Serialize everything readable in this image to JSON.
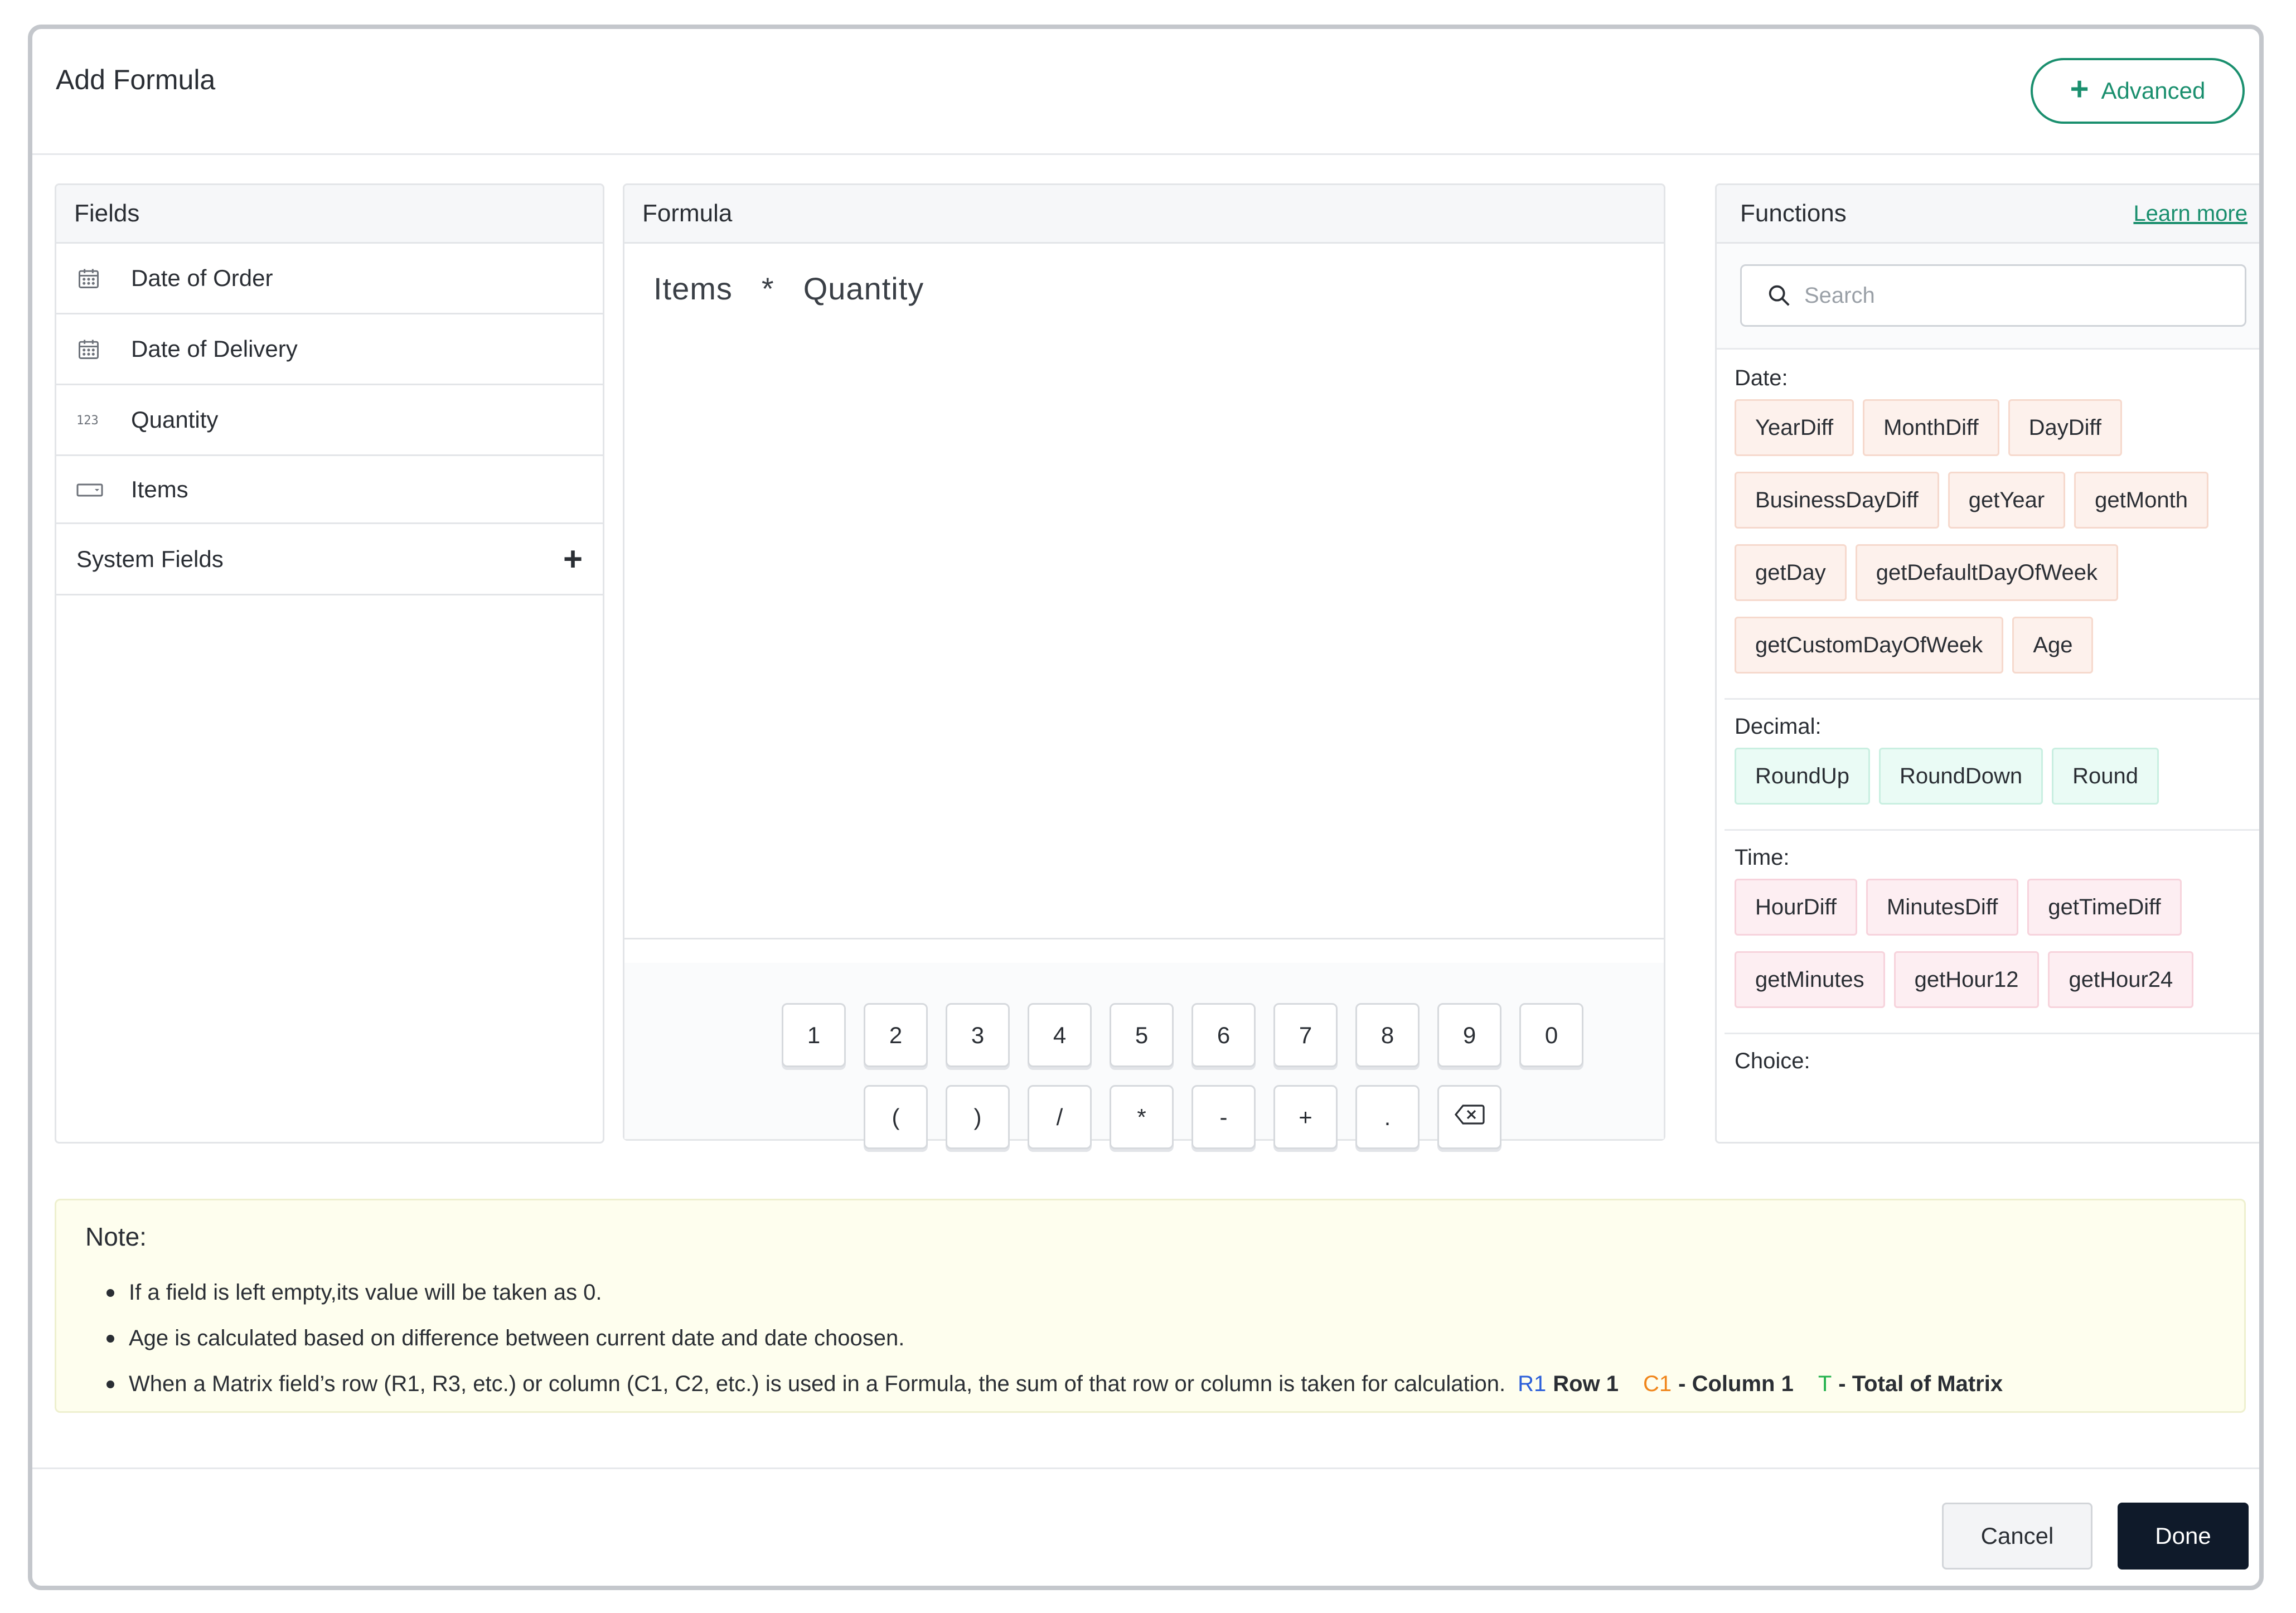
{
  "dialog": {
    "title": "Add Formula",
    "advanced_label": "Advanced"
  },
  "fields": {
    "header": "Fields",
    "items": [
      {
        "label": "Date of Order",
        "icon": "calendar-icon"
      },
      {
        "label": "Date of Delivery",
        "icon": "calendar-icon"
      },
      {
        "label": "Quantity",
        "icon": "number-123-icon"
      },
      {
        "label": "Items",
        "icon": "dropdown-field-icon"
      }
    ],
    "system_fields_label": "System Fields"
  },
  "formula": {
    "header": "Formula",
    "expression": [
      "Items",
      "*",
      "Quantity"
    ],
    "keypad_row1": [
      "1",
      "2",
      "3",
      "4",
      "5",
      "6",
      "7",
      "8",
      "9",
      "0"
    ],
    "keypad_row2": [
      "(",
      ")",
      "/",
      "*",
      "-",
      "+",
      "."
    ]
  },
  "functions": {
    "header": "Functions",
    "learn_more": "Learn more",
    "search_placeholder": "Search",
    "groups": [
      {
        "label": "Date:",
        "items": [
          "YearDiff",
          "MonthDiff",
          "DayDiff",
          "BusinessDayDiff",
          "getYear",
          "getMonth",
          "getDay",
          "getDefaultDayOfWeek",
          "getCustomDayOfWeek",
          "Age"
        ]
      },
      {
        "label": "Decimal:",
        "items": [
          "RoundUp",
          "RoundDown",
          "Round"
        ]
      },
      {
        "label": "Time:",
        "items": [
          "HourDiff",
          "MinutesDiff",
          "getTimeDiff",
          "getMinutes",
          "getHour12",
          "getHour24"
        ]
      },
      {
        "label": "Choice:",
        "items": []
      }
    ]
  },
  "note": {
    "title": "Note:",
    "items": [
      "If a field is left empty,its value will be taken as 0.",
      "Age is calculated based on difference between current date and date choosen.",
      "When a Matrix field’s row (R1, R3, etc.) or column (C1, C2, etc.) is used in a Formula, the sum of that row or column is taken for calculation."
    ],
    "legend": {
      "r_code": "R1",
      "r_text": "Row 1",
      "c_code": "C1",
      "c_text": "- Column 1",
      "t_code": "T",
      "t_text": "- Total of Matrix"
    }
  },
  "footer": {
    "cancel_label": "Cancel",
    "done_label": "Done"
  },
  "colors": {
    "accent": "#1a8f6e",
    "done_bg": "#0f1a2a",
    "date_chip": "#fdf1ec",
    "decimal_chip": "#eafbf5",
    "time_chip": "#fdeef2",
    "note_bg": "#fefeee",
    "legend_r": "#2b5fd9",
    "legend_c": "#f0851a",
    "legend_t": "#22b14c"
  }
}
